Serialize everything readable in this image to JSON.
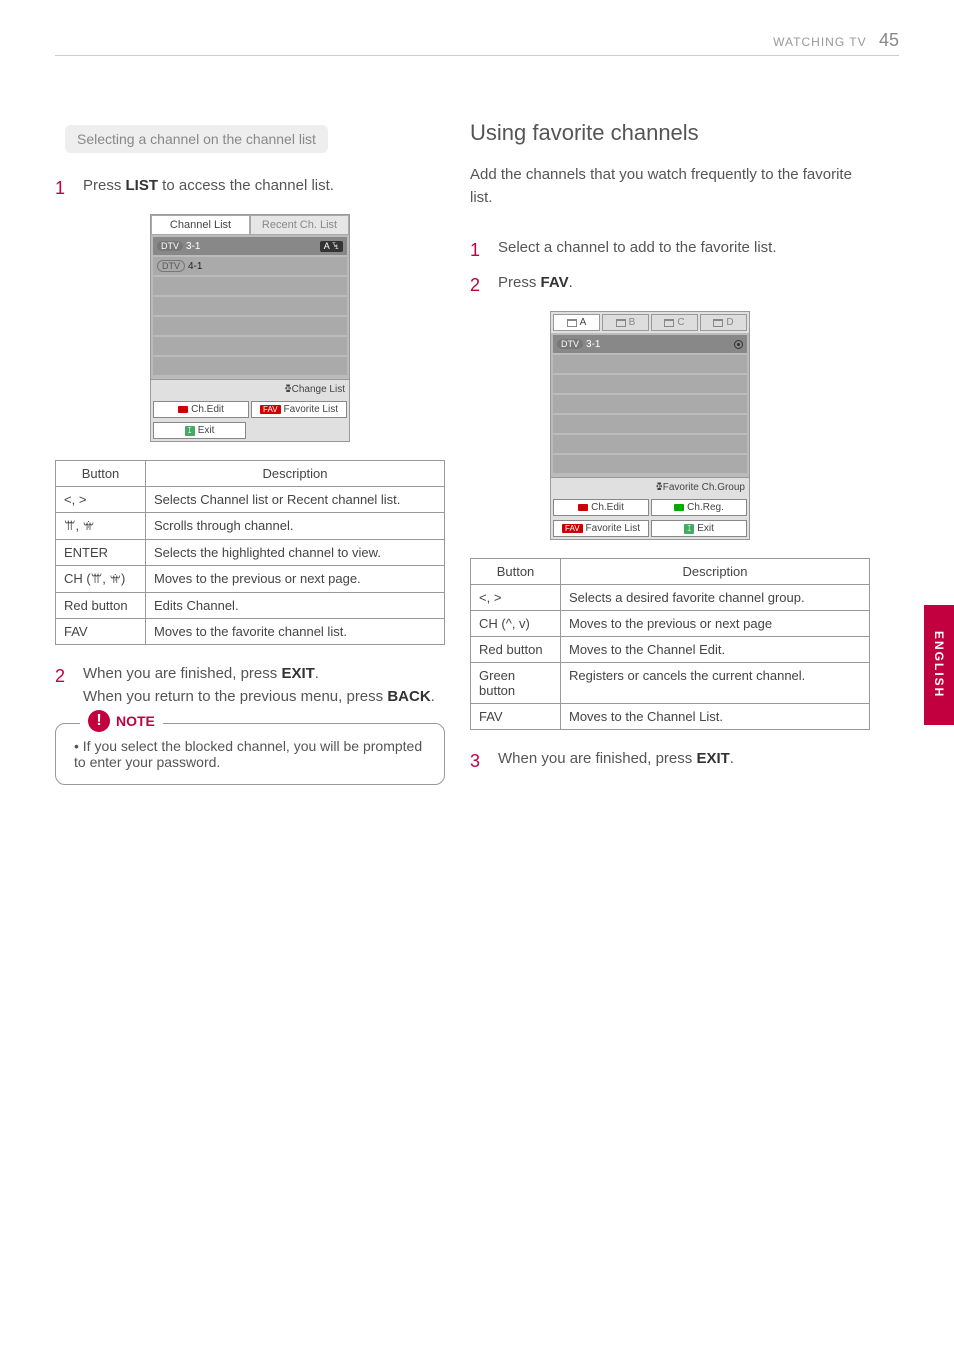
{
  "header": {
    "section": "WATCHING TV",
    "page": "45"
  },
  "sidetab": "ENGLISH",
  "left": {
    "subheading": "Selecting a channel on the channel list",
    "step1": {
      "num": "1",
      "pre": "Press ",
      "bold": "LIST",
      "post": " to access the channel list."
    },
    "ui": {
      "tab1": "Channel List",
      "tab2": "Recent Ch. List",
      "row1_pill": "DTV",
      "row1_ch": "3-1",
      "row1_badge": "A",
      "row2_pill": "DTV",
      "row2_ch": "4-1",
      "changelist": "ꔁChange List",
      "chedit": "Ch.Edit",
      "favlist": "Favorite List",
      "exit": "Exit"
    },
    "table": {
      "h1": "Button",
      "h2": "Description",
      "rows": [
        {
          "b": "<, >",
          "d": "Selects Channel list or Recent channel list."
        },
        {
          "b": "ꕌ, ꕍ",
          "d": "Scrolls through channel."
        },
        {
          "b": "ENTER",
          "d": "Selects the highlighted channel to view."
        },
        {
          "b": "CH (ꕌ, ꕍ)",
          "d": "Moves to the previous or next page."
        },
        {
          "b": "Red button",
          "d": "Edits Channel."
        },
        {
          "b": "FAV",
          "d": "Moves to the favorite channel list."
        }
      ]
    },
    "step2": {
      "num": "2",
      "line1_pre": "When you are finished, press ",
      "line1_bold": "EXIT",
      "line1_post": ".",
      "line2_pre": "When you return to the previous menu, press ",
      "line2_bold": "BACK",
      "line2_post": "."
    },
    "note": {
      "label": "NOTE",
      "text": "If you select the blocked channel, you will be prompted to enter your password."
    }
  },
  "right": {
    "heading": "Using favorite channels",
    "intro": "Add the channels that you watch frequently to the favorite list.",
    "step1": {
      "num": "1",
      "text": "Select a channel to add to the favorite list."
    },
    "step2": {
      "num": "2",
      "pre": "Press ",
      "bold": "FAV",
      "post": "."
    },
    "ui": {
      "tabs": [
        "A",
        "B",
        "C",
        "D"
      ],
      "row1_pill": "DTV",
      "row1_ch": "3-1",
      "favgroup": "ꔁFavorite Ch.Group",
      "chedit": "Ch.Edit",
      "chreg": "Ch.Reg.",
      "favlist": "Favorite List",
      "exit": "Exit"
    },
    "table": {
      "h1": "Button",
      "h2": "Description",
      "rows": [
        {
          "b": "<, >",
          "d": "Selects a desired favorite channel group."
        },
        {
          "b": "CH (^, v)",
          "d": "Moves to the previous or next page"
        },
        {
          "b": "Red button",
          "d_pre": "Moves to the ",
          "d_bold": "Channel Edit",
          "d_post": "."
        },
        {
          "b": "Green button",
          "d": "Registers or cancels the current channel."
        },
        {
          "b": "FAV",
          "d_pre": "Moves to the ",
          "d_bold": "Channel List",
          "d_post": "."
        }
      ]
    },
    "step3": {
      "num": "3",
      "pre": "When you are finished, press ",
      "bold": "EXIT",
      "post": "."
    }
  }
}
